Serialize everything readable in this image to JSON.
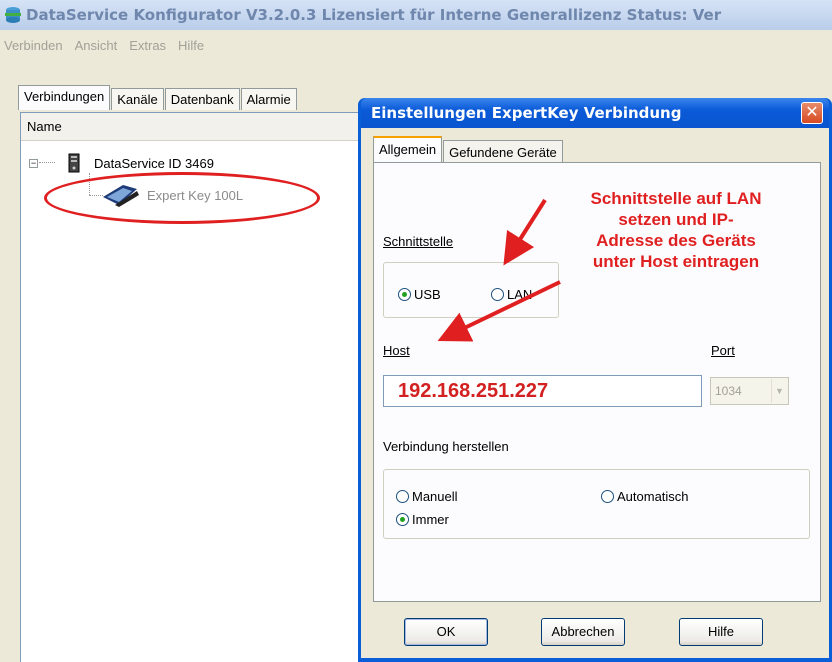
{
  "window": {
    "title": "DataService Konfigurator V3.2.0.3  Lizensiert für Interne Generallizenz   Status: Ver"
  },
  "menu": [
    "Verbinden",
    "Ansicht",
    "Extras",
    "Hilfe"
  ],
  "main_tabs": [
    {
      "label": "Verbindungen",
      "active": true
    },
    {
      "label": "Kanäle"
    },
    {
      "label": "Datenbank"
    },
    {
      "label": "Alarmie"
    }
  ],
  "tree": {
    "header": "Name",
    "root": "DataService ID 3469",
    "child": "Expert Key 100L"
  },
  "dialog": {
    "title": "Einstellungen ExpertKey Verbindung",
    "close_glyph": "✕",
    "tabs": [
      {
        "label": "Allgemein",
        "active": true
      },
      {
        "label": "Gefundene Geräte"
      }
    ],
    "schnittstelle_label": "Schnittstelle",
    "schnittstelle_options": [
      {
        "label": "USB",
        "checked": true
      },
      {
        "label": "LAN",
        "checked": false
      }
    ],
    "host_label": "Host",
    "host_value": "192.168.251.227",
    "port_label": "Port",
    "port_value": "1034",
    "verbindung_label": "Verbindung herstellen",
    "verbindung_options": [
      {
        "label": "Manuell",
        "checked": false
      },
      {
        "label": "Automatisch",
        "checked": false
      },
      {
        "label": "Immer",
        "checked": true
      }
    ],
    "buttons": {
      "ok": "OK",
      "cancel": "Abbrechen",
      "help": "Hilfe"
    }
  },
  "annotation": {
    "lines": [
      "Schnittstelle auf LAN",
      "setzen und IP-",
      "Adresse des Geräts",
      "unter Host eintragen"
    ],
    "color": "#e02020"
  }
}
